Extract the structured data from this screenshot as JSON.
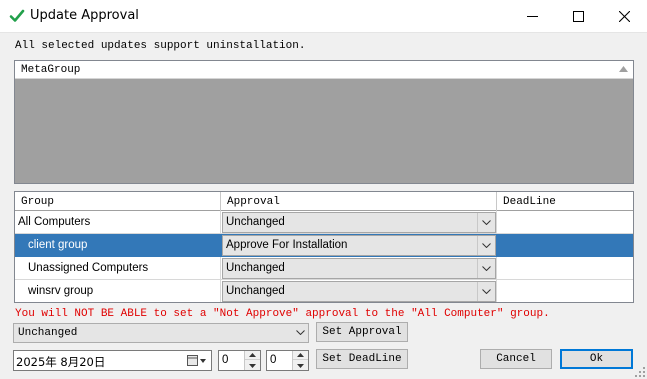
{
  "window": {
    "title": "Update Approval",
    "icon": "green-checkmark-icon"
  },
  "info_text": "All selected updates support uninstallation.",
  "metagroup_list": {
    "column_header": "MetaGroup"
  },
  "approval_grid": {
    "columns": [
      "Group",
      "Approval",
      "DeadLine"
    ],
    "rows": [
      {
        "group": "All Computers",
        "approval": "Unchanged",
        "deadline": "",
        "selected": false
      },
      {
        "group": "client group",
        "approval": "Approve For Installation",
        "deadline": "",
        "selected": true
      },
      {
        "group": "Unassigned Computers",
        "approval": "Unchanged",
        "deadline": "",
        "selected": false
      },
      {
        "group": "winsrv group",
        "approval": "Unchanged",
        "deadline": "",
        "selected": false
      }
    ]
  },
  "warning_text": "You will NOT BE ABLE to set a \"Not Approve\" approval to the \"All Computer\" group.",
  "controls": {
    "approval_select_value": "Unchanged",
    "set_approval_label": "Set Approval",
    "date_value": "2025年  8月20日",
    "hour_value": "0",
    "minute_value": "0",
    "set_deadline_label": "Set DeadLine",
    "cancel_label": "Cancel",
    "ok_label": "Ok"
  },
  "colors": {
    "selection": "#3378b8",
    "warning": "#e00000",
    "check_icon": "#22a04b"
  }
}
